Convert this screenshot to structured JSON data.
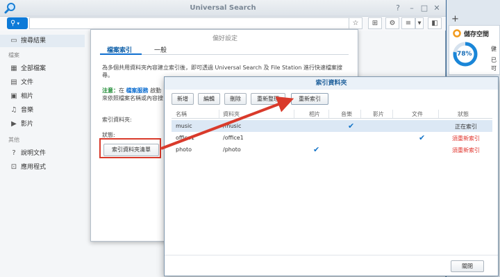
{
  "app": {
    "title": "Universal Search"
  },
  "sidebar": {
    "items": [
      {
        "label": "搜尋結果",
        "icon": "monitor-icon"
      },
      {
        "label": "全部檔案",
        "icon": "grid-icon"
      },
      {
        "label": "文件",
        "icon": "document-icon"
      },
      {
        "label": "相片",
        "icon": "photo-icon"
      },
      {
        "label": "音樂",
        "icon": "music-icon"
      },
      {
        "label": "影片",
        "icon": "video-icon"
      },
      {
        "label": "說明文件",
        "icon": "help-icon"
      },
      {
        "label": "應用程式",
        "icon": "apps-icon"
      }
    ],
    "sections": [
      "檔案",
      "其他"
    ]
  },
  "preferences": {
    "title": "偏好設定",
    "tabs": [
      "檔案索引",
      "一般"
    ],
    "description": "為多個共用資料夾內容建立索引後，即可透過 Universal Search 及 File Station 進行快速檔案搜尋。",
    "note_label": "注意：",
    "note_text_1": "在",
    "note_link": "檔案服務",
    "note_text_2": "啟動",
    "note_line2": "來依照檔案名稱或內容搜",
    "index_folder_label": "索引資料夾:",
    "status_label": "狀態:",
    "index_list_button": "索引資料夾清單"
  },
  "index_dialog": {
    "title": "索引資料夾",
    "buttons": [
      "新增",
      "編輯",
      "刪除",
      "重新整理",
      "重新索引"
    ],
    "columns": [
      "名稱",
      "資料夾",
      "相片",
      "音樂",
      "影片",
      "文件",
      "狀態"
    ],
    "rows": [
      {
        "name": "music",
        "folder": "/music",
        "photo": false,
        "music": true,
        "video": false,
        "doc": false,
        "status": "正在索引",
        "status_type": "ok"
      },
      {
        "name": "office1",
        "folder": "/office1",
        "photo": false,
        "music": false,
        "video": false,
        "doc": true,
        "status": "須重新索引",
        "status_type": "red"
      },
      {
        "name": "photo",
        "folder": "/photo",
        "photo": true,
        "music": false,
        "video": false,
        "doc": false,
        "status": "須重新索引",
        "status_type": "red"
      }
    ],
    "close_button": "關閉"
  },
  "storage_widget": {
    "title": "儲存空間",
    "percent": "78%",
    "percent_value": 78,
    "text1": "健",
    "text2": "已",
    "text3": "可"
  },
  "colors": {
    "accent": "#0d7ad8",
    "highlight_red": "#d93a2b",
    "status_red": "#e0312a"
  }
}
